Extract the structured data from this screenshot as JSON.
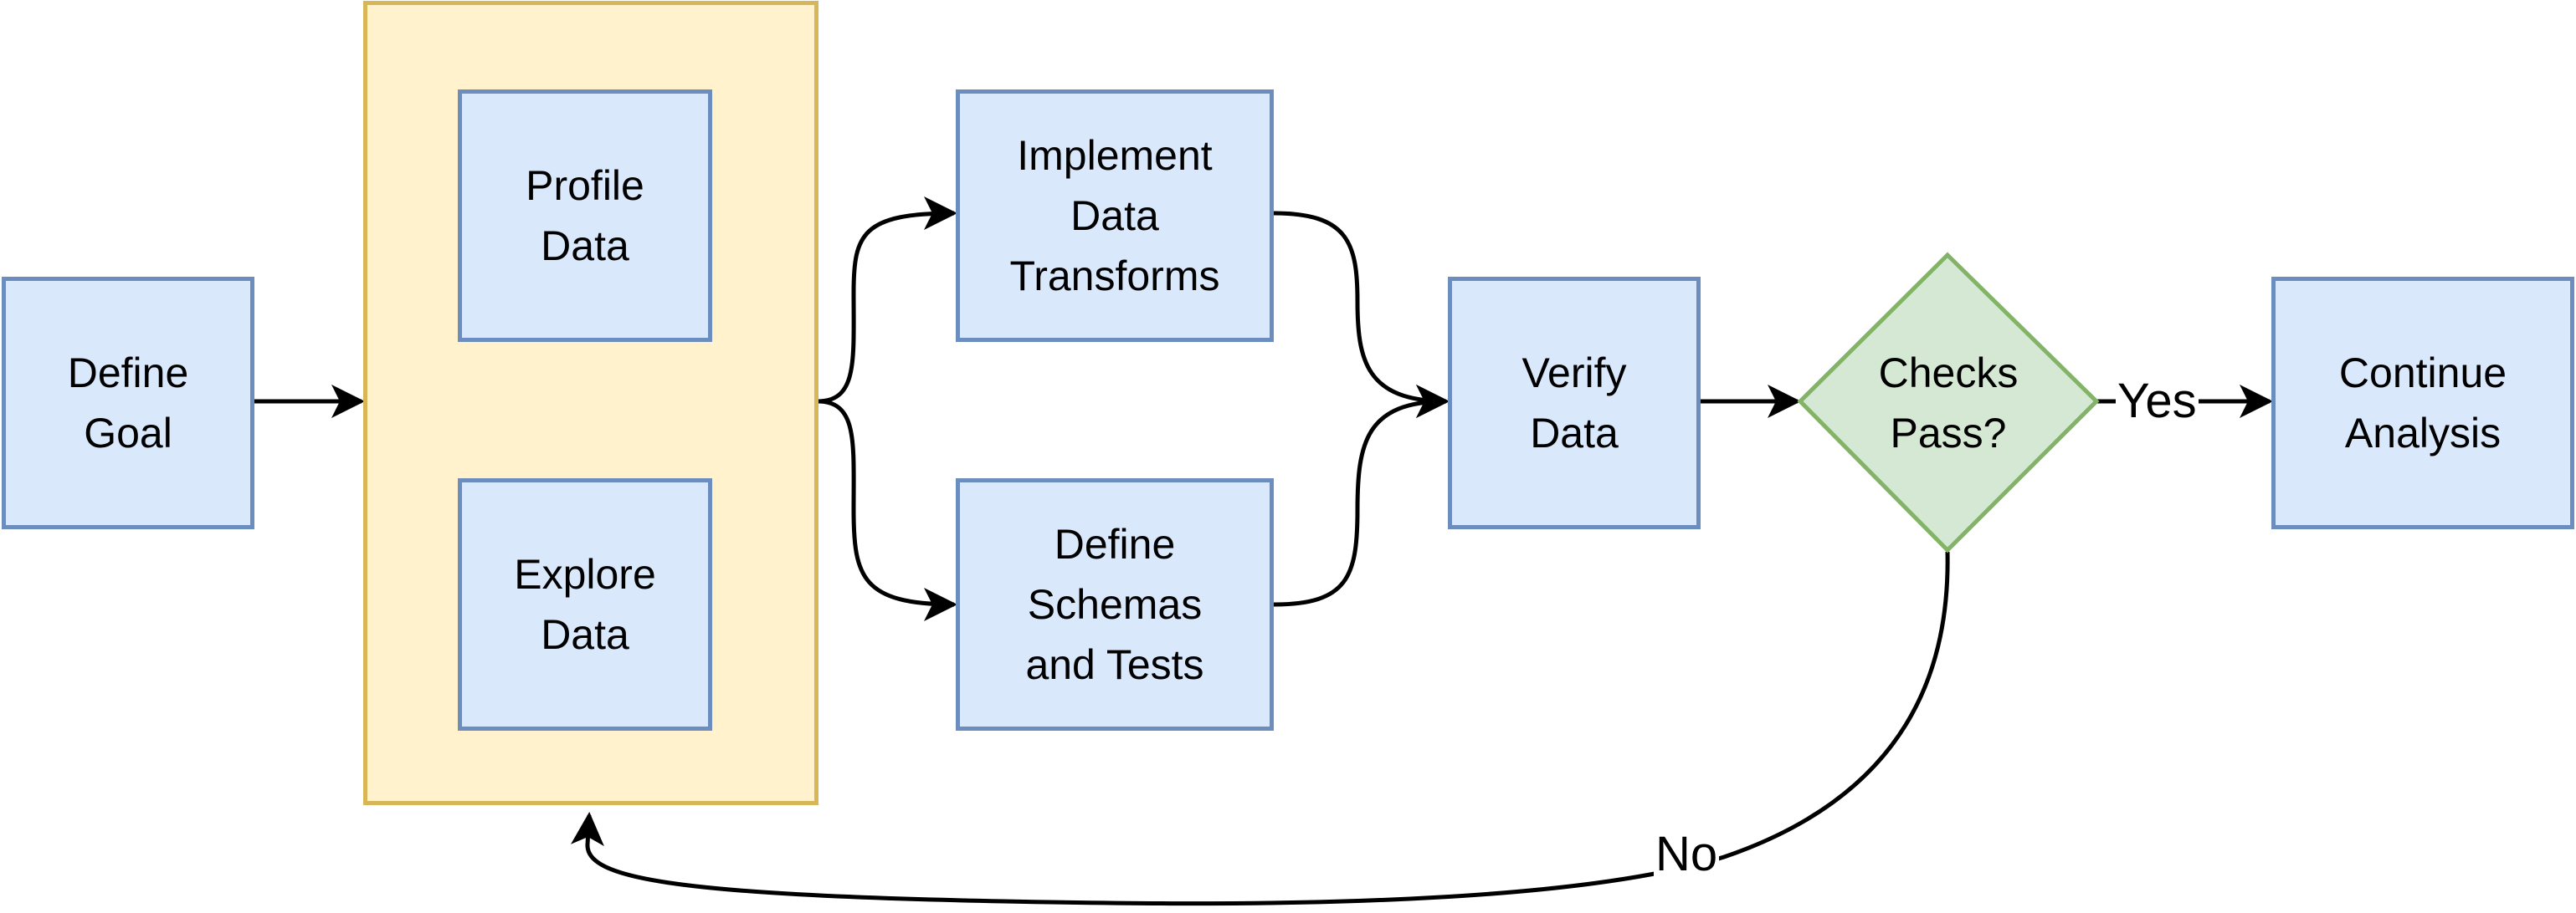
{
  "diagram": {
    "colors": {
      "process_fill": "#dae8fc",
      "process_stroke": "#6c8ebf",
      "group_fill": "#fff2cc",
      "group_stroke": "#d6b656",
      "decision_fill": "#d5e8d4",
      "decision_stroke": "#82b366",
      "edge": "#000000",
      "bidirectional_edge": "#999999"
    },
    "nodes": {
      "define_goal": "Define\nGoal",
      "profile_data": "Profile\nData",
      "explore_data": "Explore\nData",
      "implement_transforms": "Implement\nData\nTransforms",
      "define_schemas": "Define\nSchemas\nand Tests",
      "verify_data": "Verify\nData",
      "checks_pass": "Checks\nPass?",
      "continue_analysis": "Continue\nAnalysis"
    },
    "edge_labels": {
      "yes": "Yes",
      "no": "No"
    },
    "edges": [
      {
        "from": "Define Goal",
        "to": "Profile/Explore group"
      },
      {
        "from": "Profile Data",
        "to": "Explore Data",
        "type": "bidirectional"
      },
      {
        "from": "Profile/Explore group",
        "to": "Implement Data Transforms"
      },
      {
        "from": "Profile/Explore group",
        "to": "Define Schemas and Tests"
      },
      {
        "from": "Implement Data Transforms",
        "to": "Verify Data"
      },
      {
        "from": "Define Schemas and Tests",
        "to": "Verify Data"
      },
      {
        "from": "Verify Data",
        "to": "Checks Pass?"
      },
      {
        "from": "Checks Pass?",
        "to": "Continue Analysis",
        "label": "Yes"
      },
      {
        "from": "Checks Pass?",
        "to": "Profile/Explore group",
        "label": "No"
      }
    ]
  }
}
